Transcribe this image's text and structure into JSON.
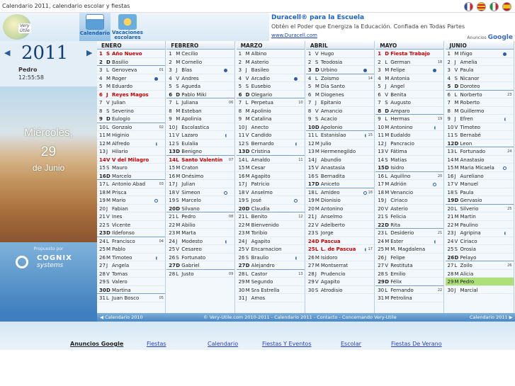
{
  "window": {
    "title": "Calendario 2011, calendario escolar y fiestas"
  },
  "colors": {
    "festivo": "#c80000",
    "today": "#aee07a",
    "accent": "#1a5fa8"
  },
  "header": {
    "logo_text": "Very Útile",
    "tab_calendario": "Calendario",
    "tab_vacaciones_1": "Vacaciones",
    "tab_vacaciones_2": "escolares"
  },
  "ad": {
    "headline": "Duracell® para la Escuela",
    "description": "Obtén el Poder que Energiza la Educación. Confiada en Todas Partes",
    "url": "www.Duracell.com",
    "by": "Anuncios",
    "brand": "Google"
  },
  "sidebar": {
    "year": "2011",
    "prev_icon": "◀",
    "next_icon": "▶",
    "user": "Pedro",
    "clock": "12:55:58",
    "day_name": "Miércoles,",
    "day_number": "29",
    "month_text": "de Junio",
    "promo": "Propuesto por",
    "company": "COGNIX",
    "company_sub": "systems"
  },
  "months": [
    {
      "name": "ENERO",
      "days": [
        {
          "n": "1",
          "l": "S",
          "nm": "Año Nuevo",
          "f": true
        },
        {
          "n": "2",
          "l": "D",
          "nm": "Basilio",
          "s": true
        },
        {
          "n": "3",
          "l": "L",
          "nm": "Genoveva",
          "wk": "01"
        },
        {
          "n": "4",
          "l": "M",
          "nm": "Roger",
          "mo": "full"
        },
        {
          "n": "5",
          "l": "M",
          "nm": "Eduardo"
        },
        {
          "n": "6",
          "l": "J",
          "nm": "Reyes Magos",
          "f": true
        },
        {
          "n": "7",
          "l": "V",
          "nm": "Julian"
        },
        {
          "n": "8",
          "l": "S",
          "nm": "Severino"
        },
        {
          "n": "9",
          "l": "D",
          "nm": "Eulogio",
          "s": true
        },
        {
          "n": "10",
          "l": "L",
          "nm": "Gonzalo",
          "wk": "02"
        },
        {
          "n": "11",
          "l": "M",
          "nm": "Higinio"
        },
        {
          "n": "12",
          "l": "M",
          "nm": "Alfredo",
          "mo": "half"
        },
        {
          "n": "13",
          "l": "J",
          "nm": "Hilario"
        },
        {
          "n": "14",
          "l": "V",
          "nm": "V del Milagro",
          "f": true
        },
        {
          "n": "15",
          "l": "S",
          "nm": "Mauro"
        },
        {
          "n": "16",
          "l": "D",
          "nm": "Marcelo",
          "s": true
        },
        {
          "n": "17",
          "l": "L",
          "nm": "Antonio Abad",
          "wk": "03"
        },
        {
          "n": "18",
          "l": "M",
          "nm": "Prisca"
        },
        {
          "n": "19",
          "l": "M",
          "nm": "Mario",
          "mo": "empty"
        },
        {
          "n": "20",
          "l": "J",
          "nm": "Fabian"
        },
        {
          "n": "21",
          "l": "V",
          "nm": "Ines"
        },
        {
          "n": "22",
          "l": "S",
          "nm": "Vicente"
        },
        {
          "n": "23",
          "l": "D",
          "nm": "Ildefonso",
          "s": true
        },
        {
          "n": "24",
          "l": "L",
          "nm": "Francisco",
          "wk": "04"
        },
        {
          "n": "25",
          "l": "M",
          "nm": "Pablo"
        },
        {
          "n": "26",
          "l": "M",
          "nm": "Timoteo",
          "mo": "half"
        },
        {
          "n": "27",
          "l": "J",
          "nm": "Angela"
        },
        {
          "n": "28",
          "l": "V",
          "nm": "Tomas"
        },
        {
          "n": "29",
          "l": "S",
          "nm": "Valero"
        },
        {
          "n": "30",
          "l": "D",
          "nm": "Martina",
          "s": true
        },
        {
          "n": "31",
          "l": "L",
          "nm": "Juan Bosco",
          "wk": "05"
        }
      ]
    },
    {
      "name": "FEBRERO",
      "days": [
        {
          "n": "1",
          "l": "M",
          "nm": "Cecilio"
        },
        {
          "n": "2",
          "l": "M",
          "nm": "Cornelio"
        },
        {
          "n": "3",
          "l": "J",
          "nm": "Blas",
          "mo": "full"
        },
        {
          "n": "4",
          "l": "V",
          "nm": "Andres"
        },
        {
          "n": "5",
          "l": "S",
          "nm": "Agueda"
        },
        {
          "n": "6",
          "l": "D",
          "nm": "Pablo Miki",
          "s": true
        },
        {
          "n": "7",
          "l": "L",
          "nm": "Juliana",
          "wk": "06"
        },
        {
          "n": "8",
          "l": "M",
          "nm": "Esteban"
        },
        {
          "n": "9",
          "l": "M",
          "nm": "Apolinia"
        },
        {
          "n": "10",
          "l": "J",
          "nm": "Escolastica"
        },
        {
          "n": "11",
          "l": "V",
          "nm": "Lazaro",
          "mo": "half"
        },
        {
          "n": "12",
          "l": "S",
          "nm": "Eulalia"
        },
        {
          "n": "13",
          "l": "D",
          "nm": "Benigno",
          "s": true
        },
        {
          "n": "14",
          "l": "L",
          "nm": "Santo Valentín",
          "f": true,
          "wk": "07"
        },
        {
          "n": "15",
          "l": "M",
          "nm": "Craton"
        },
        {
          "n": "16",
          "l": "M",
          "nm": "Onésimo"
        },
        {
          "n": "17",
          "l": "J",
          "nm": "Julian"
        },
        {
          "n": "18",
          "l": "V",
          "nm": "Simeon",
          "mo": "empty"
        },
        {
          "n": "19",
          "l": "S",
          "nm": "Marcelo"
        },
        {
          "n": "20",
          "l": "D",
          "nm": "Silvano",
          "s": true
        },
        {
          "n": "21",
          "l": "L",
          "nm": "Pedro",
          "wk": "08"
        },
        {
          "n": "22",
          "l": "M",
          "nm": "Abilio"
        },
        {
          "n": "23",
          "l": "M",
          "nm": "Marta"
        },
        {
          "n": "24",
          "l": "J",
          "nm": "Modesto",
          "mo": "half"
        },
        {
          "n": "25",
          "l": "V",
          "nm": "Cesareo"
        },
        {
          "n": "26",
          "l": "S",
          "nm": "Fortunato"
        },
        {
          "n": "27",
          "l": "D",
          "nm": "Gabriel",
          "s": true
        },
        {
          "n": "28",
          "l": "L",
          "nm": "Justo",
          "wk": "09"
        }
      ]
    },
    {
      "name": "MARZO",
      "days": [
        {
          "n": "1",
          "l": "M",
          "nm": "Albino"
        },
        {
          "n": "2",
          "l": "M",
          "nm": "Asterio"
        },
        {
          "n": "3",
          "l": "J",
          "nm": "Basileo"
        },
        {
          "n": "4",
          "l": "V",
          "nm": "Arcadio",
          "mo": "full"
        },
        {
          "n": "5",
          "l": "S",
          "nm": "Eusebio"
        },
        {
          "n": "6",
          "l": "D",
          "nm": "Olegario",
          "s": true
        },
        {
          "n": "7",
          "l": "L",
          "nm": "Perpetua",
          "wk": "10"
        },
        {
          "n": "8",
          "l": "M",
          "nm": "Apolinio"
        },
        {
          "n": "9",
          "l": "M",
          "nm": "Catalina"
        },
        {
          "n": "10",
          "l": "J",
          "nm": "Anecto"
        },
        {
          "n": "11",
          "l": "V",
          "nm": "Candido"
        },
        {
          "n": "12",
          "l": "S",
          "nm": "Bernardo",
          "mo": "half"
        },
        {
          "n": "13",
          "l": "D",
          "nm": "Cristina",
          "s": true
        },
        {
          "n": "14",
          "l": "L",
          "nm": "Amaldo",
          "wk": "11"
        },
        {
          "n": "15",
          "l": "M",
          "nm": "Cesar"
        },
        {
          "n": "16",
          "l": "M",
          "nm": "Agapito"
        },
        {
          "n": "17",
          "l": "J",
          "nm": "Patricio"
        },
        {
          "n": "18",
          "l": "V",
          "nm": "Anselmo"
        },
        {
          "n": "19",
          "l": "S",
          "nm": "José",
          "mo": "empty"
        },
        {
          "n": "20",
          "l": "D",
          "nm": "Claudia",
          "s": true
        },
        {
          "n": "21",
          "l": "L",
          "nm": "Benito",
          "wk": "12"
        },
        {
          "n": "22",
          "l": "M",
          "nm": "Bienvenido"
        },
        {
          "n": "23",
          "l": "M",
          "nm": "Toribio"
        },
        {
          "n": "24",
          "l": "J",
          "nm": "Agapito"
        },
        {
          "n": "25",
          "l": "V",
          "nm": "Encarnacion"
        },
        {
          "n": "26",
          "l": "S",
          "nm": "Braulio",
          "mo": "half"
        },
        {
          "n": "27",
          "l": "D",
          "nm": "Alejandro",
          "s": true
        },
        {
          "n": "28",
          "l": "L",
          "nm": "Castor",
          "wk": "13"
        },
        {
          "n": "29",
          "l": "M",
          "nm": "Segundo"
        },
        {
          "n": "30",
          "l": "M",
          "nm": "Sra Estrella"
        },
        {
          "n": "31",
          "l": "J",
          "nm": "Amos"
        }
      ]
    },
    {
      "name": "ABRIL",
      "days": [
        {
          "n": "1",
          "l": "V",
          "nm": "Hugo"
        },
        {
          "n": "2",
          "l": "S",
          "nm": "Teodosia"
        },
        {
          "n": "3",
          "l": "D",
          "nm": "Urbino",
          "s": true,
          "mo": "full"
        },
        {
          "n": "4",
          "l": "L",
          "nm": "Zoismo",
          "wk": "14"
        },
        {
          "n": "5",
          "l": "M",
          "nm": "Dia Santo"
        },
        {
          "n": "6",
          "l": "M",
          "nm": "Diogenes"
        },
        {
          "n": "7",
          "l": "J",
          "nm": "Epitanio"
        },
        {
          "n": "8",
          "l": "V",
          "nm": "Amancio"
        },
        {
          "n": "9",
          "l": "S",
          "nm": "Acacio"
        },
        {
          "n": "10",
          "l": "D",
          "nm": "Apolonio",
          "s": true
        },
        {
          "n": "11",
          "l": "L",
          "nm": "Estanislao",
          "wk": "15",
          "mo": "half"
        },
        {
          "n": "12",
          "l": "M",
          "nm": "Julio"
        },
        {
          "n": "13",
          "l": "M",
          "nm": "Hermenegildo"
        },
        {
          "n": "14",
          "l": "J",
          "nm": "Abundio"
        },
        {
          "n": "15",
          "l": "V",
          "nm": "Anastasia"
        },
        {
          "n": "16",
          "l": "S",
          "nm": "Bernadita"
        },
        {
          "n": "17",
          "l": "D",
          "nm": "Aniceto",
          "s": true
        },
        {
          "n": "18",
          "l": "L",
          "nm": "Amideo",
          "wk": "16",
          "mo": "empty"
        },
        {
          "n": "19",
          "l": "M",
          "nm": "Dionisio"
        },
        {
          "n": "20",
          "l": "M",
          "nm": "Antonino"
        },
        {
          "n": "21",
          "l": "J",
          "nm": "Anselmo"
        },
        {
          "n": "22",
          "l": "V",
          "nm": "Adelberto"
        },
        {
          "n": "23",
          "l": "S",
          "nm": "Jorge"
        },
        {
          "n": "24",
          "l": "D",
          "nm": "Pascua",
          "f": true
        },
        {
          "n": "25",
          "l": "L",
          "nm": "L. de Pascua",
          "f": true,
          "wk": "17",
          "mo": "half"
        },
        {
          "n": "26",
          "l": "M",
          "nm": "Isidoro"
        },
        {
          "n": "27",
          "l": "M",
          "nm": "Montserrat"
        },
        {
          "n": "28",
          "l": "J",
          "nm": "Prudencio"
        },
        {
          "n": "29",
          "l": "V",
          "nm": "Agapito"
        },
        {
          "n": "30",
          "l": "S",
          "nm": "Atrodisio"
        }
      ]
    },
    {
      "name": "MAYO",
      "days": [
        {
          "n": "1",
          "l": "D",
          "nm": "Fiesta Trabajo",
          "f": true
        },
        {
          "n": "2",
          "l": "L",
          "nm": "German",
          "wk": "18"
        },
        {
          "n": "3",
          "l": "M",
          "nm": "Felipe",
          "mo": "full"
        },
        {
          "n": "4",
          "l": "M",
          "nm": "Antonia"
        },
        {
          "n": "5",
          "l": "J",
          "nm": "Angel"
        },
        {
          "n": "6",
          "l": "V",
          "nm": "Benita"
        },
        {
          "n": "7",
          "l": "S",
          "nm": "Augusto"
        },
        {
          "n": "8",
          "l": "D",
          "nm": "Amparo",
          "s": true
        },
        {
          "n": "9",
          "l": "L",
          "nm": "Hermas",
          "wk": "19"
        },
        {
          "n": "10",
          "l": "M",
          "nm": "Antonino",
          "mo": "half"
        },
        {
          "n": "11",
          "l": "M",
          "nm": "Eudaldo"
        },
        {
          "n": "12",
          "l": "J",
          "nm": "Pancracio"
        },
        {
          "n": "13",
          "l": "V",
          "nm": "Fátima"
        },
        {
          "n": "14",
          "l": "S",
          "nm": "Matias"
        },
        {
          "n": "15",
          "l": "D",
          "nm": "Isidro",
          "s": true
        },
        {
          "n": "16",
          "l": "L",
          "nm": "Aquilino",
          "wk": "20"
        },
        {
          "n": "17",
          "l": "M",
          "nm": "Adrión",
          "mo": "empty"
        },
        {
          "n": "18",
          "l": "M",
          "nm": "Venancio"
        },
        {
          "n": "19",
          "l": "J",
          "nm": "Ciriaco"
        },
        {
          "n": "20",
          "l": "V",
          "nm": "Asterio"
        },
        {
          "n": "21",
          "l": "S",
          "nm": "Felicia"
        },
        {
          "n": "22",
          "l": "D",
          "nm": "Rita",
          "s": true
        },
        {
          "n": "23",
          "l": "L",
          "nm": "Desiderio",
          "wk": "21"
        },
        {
          "n": "24",
          "l": "M",
          "nm": "Ester",
          "mo": "half"
        },
        {
          "n": "25",
          "l": "M",
          "nm": "M. Magdalena"
        },
        {
          "n": "26",
          "l": "J",
          "nm": "Felipe"
        },
        {
          "n": "27",
          "l": "V",
          "nm": "Restituta"
        },
        {
          "n": "28",
          "l": "S",
          "nm": "Emilio"
        },
        {
          "n": "29",
          "l": "D",
          "nm": "Félix",
          "s": true
        },
        {
          "n": "30",
          "l": "L",
          "nm": "Fernando",
          "wk": "22"
        },
        {
          "n": "31",
          "l": "M",
          "nm": "Petrolina"
        }
      ]
    },
    {
      "name": "JUNIO",
      "days": [
        {
          "n": "1",
          "l": "M",
          "nm": "Iñigo",
          "mo": "full"
        },
        {
          "n": "2",
          "l": "J",
          "nm": "Amelia"
        },
        {
          "n": "3",
          "l": "V",
          "nm": "Paula"
        },
        {
          "n": "4",
          "l": "S",
          "nm": "Nicanor"
        },
        {
          "n": "5",
          "l": "D",
          "nm": "Doroteo",
          "s": true
        },
        {
          "n": "6",
          "l": "L",
          "nm": "Norberto",
          "wk": "23"
        },
        {
          "n": "7",
          "l": "M",
          "nm": "Roberto"
        },
        {
          "n": "8",
          "l": "M",
          "nm": "Guillermo"
        },
        {
          "n": "9",
          "l": "J",
          "nm": "Efren",
          "mo": "half"
        },
        {
          "n": "10",
          "l": "V",
          "nm": "Timoteo"
        },
        {
          "n": "11",
          "l": "S",
          "nm": "Bernabé"
        },
        {
          "n": "12",
          "l": "D",
          "nm": "Leon",
          "s": true
        },
        {
          "n": "13",
          "l": "L",
          "nm": "Fortunado",
          "wk": "24"
        },
        {
          "n": "14",
          "l": "M",
          "nm": "Anastasio"
        },
        {
          "n": "15",
          "l": "M",
          "nm": "Maria Micaela",
          "mo": "empty"
        },
        {
          "n": "16",
          "l": "J",
          "nm": "Aureliano"
        },
        {
          "n": "17",
          "l": "V",
          "nm": "Manuel"
        },
        {
          "n": "18",
          "l": "S",
          "nm": "Paula"
        },
        {
          "n": "19",
          "l": "D",
          "nm": "Gervasio",
          "s": true
        },
        {
          "n": "20",
          "l": "L",
          "nm": "Silverio",
          "wk": "25"
        },
        {
          "n": "21",
          "l": "M",
          "nm": "Martin"
        },
        {
          "n": "22",
          "l": "M",
          "nm": "Paulino"
        },
        {
          "n": "23",
          "l": "J",
          "nm": "Agripina",
          "mo": "half"
        },
        {
          "n": "24",
          "l": "V",
          "nm": "Ciriaco"
        },
        {
          "n": "25",
          "l": "S",
          "nm": "Orosia"
        },
        {
          "n": "26",
          "l": "D",
          "nm": "Pelayo",
          "s": true
        },
        {
          "n": "27",
          "l": "L",
          "nm": "Zoilo",
          "wk": "26"
        },
        {
          "n": "28",
          "l": "M",
          "nm": "Alicia"
        },
        {
          "n": "29",
          "l": "M",
          "nm": "Pedro",
          "t": true
        },
        {
          "n": "30",
          "l": "J",
          "nm": "Marcial"
        }
      ]
    }
  ],
  "bottombar": {
    "prev": "◀ Calendario 2010",
    "center": "© Very-Utile.com 2010-2011 - Calendario 2011 - Contacto - Concernando Very-Utile",
    "next": "Calendario 2011 ▶"
  },
  "footer": {
    "ads_label": "Anuncios Google",
    "links": [
      "Fiestas",
      "Calendario",
      "Fiestas Y Eventos",
      "Escolar",
      "Fiestas De Verano"
    ]
  }
}
